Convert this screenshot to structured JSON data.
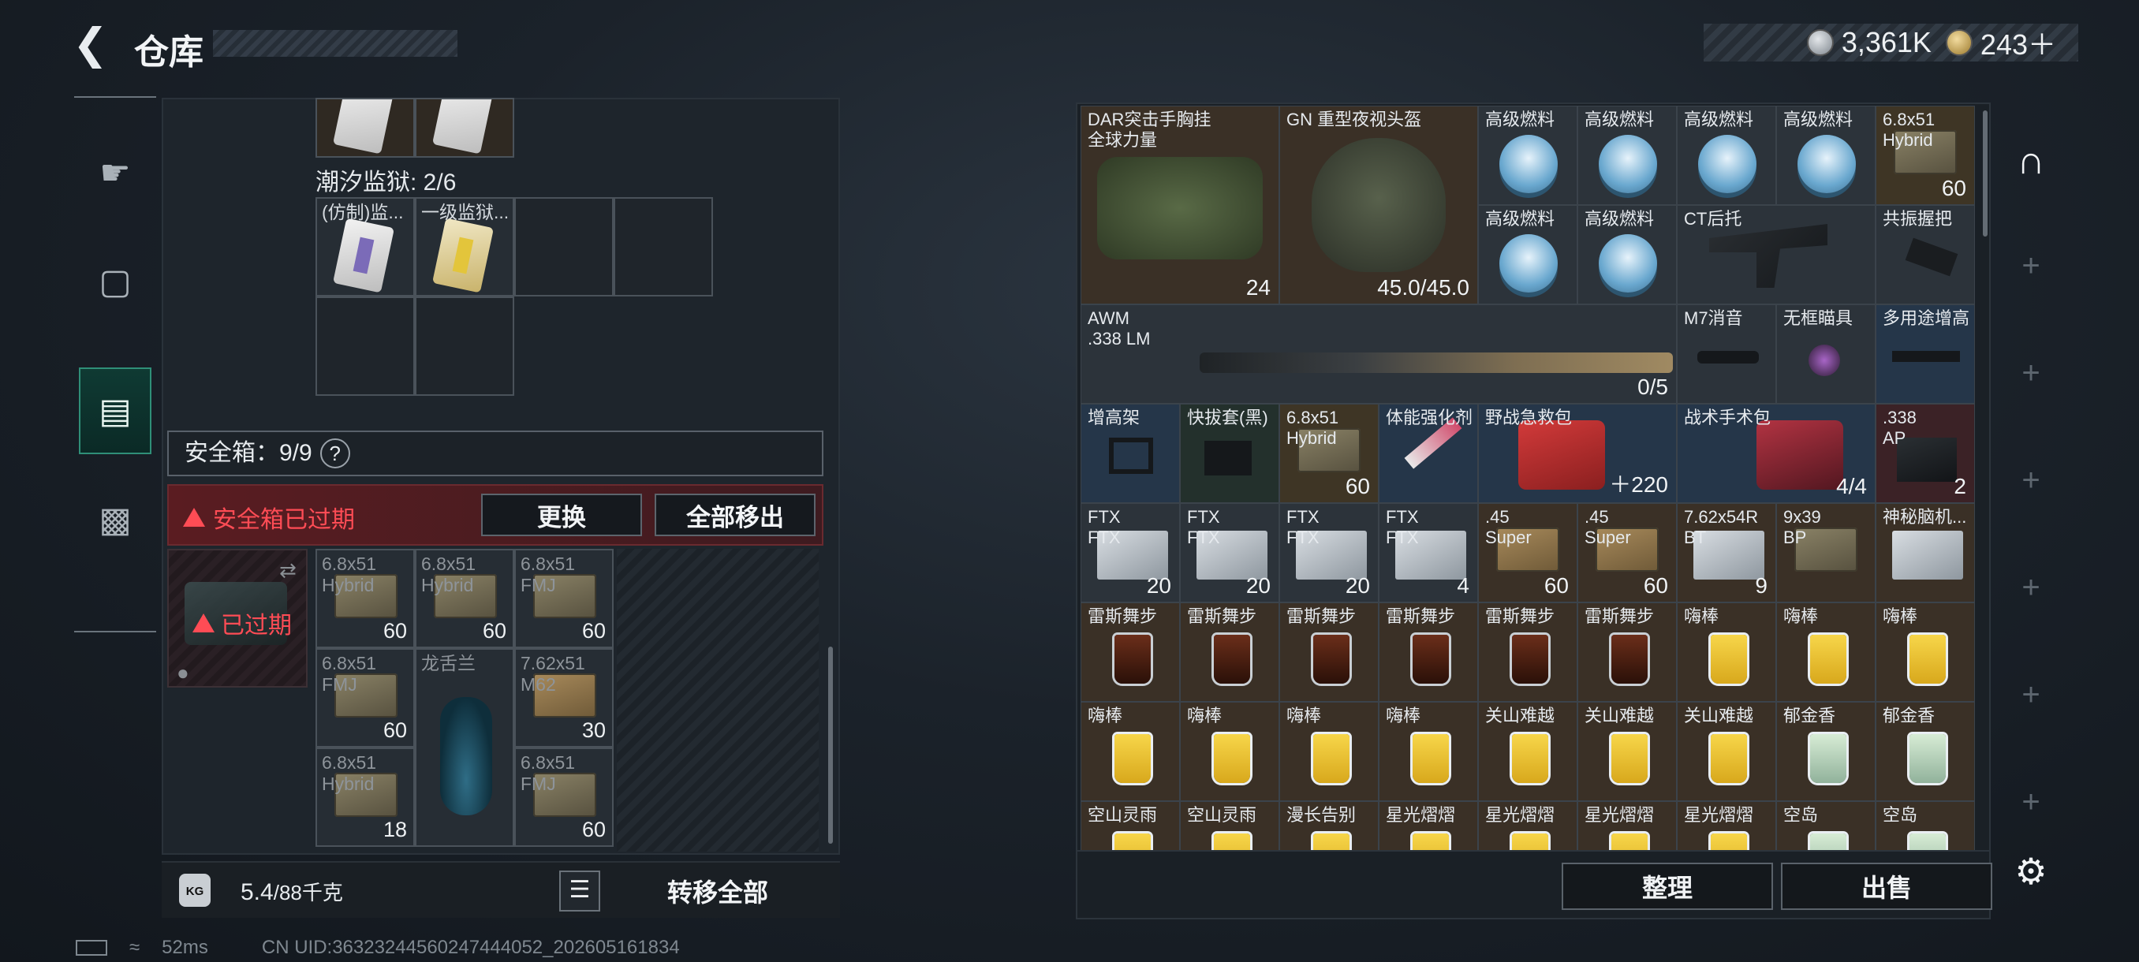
{
  "header": {
    "back_icon": "back-arrow-icon",
    "title": "仓库"
  },
  "currency": [
    {
      "icon": "silver-coin-icon",
      "value": "3,361K"
    },
    {
      "icon": "gold-coin-icon",
      "value": "243＋"
    }
  ],
  "left_rail": {
    "items": [
      "weapon-icon",
      "backpack-icon",
      "safe-box-icon",
      "briefcase-icon"
    ],
    "active": "safe-box-icon"
  },
  "left_panel": {
    "prison_section": {
      "label": "潮汐监狱: 2/6",
      "cards": [
        "(仿制)监...",
        "一级监狱..."
      ]
    },
    "safe_box": {
      "label": "安全箱：9/9",
      "help": "?"
    },
    "expired": {
      "warning": "安全箱已过期",
      "replace": "更换",
      "remove_all": "全部移出",
      "badge": "已过期"
    },
    "items": [
      {
        "label": "6.8x51\nHybrid",
        "count": "60"
      },
      {
        "label": "6.8x51\nHybrid",
        "count": "60"
      },
      {
        "label": "6.8x51\nFMJ",
        "count": "60"
      },
      {
        "label": "6.8x51\nFMJ",
        "count": "60"
      },
      {
        "label": "龙舌兰",
        "count": ""
      },
      {
        "label": "7.62x51\nM62",
        "count": "30"
      },
      {
        "label": "6.8x51\nHybrid",
        "count": "18"
      },
      {
        "label": "6.8x51\nFMJ",
        "count": "60"
      }
    ],
    "weight": {
      "icon_text": "KG",
      "current": "5.4",
      "max": "/88千克"
    },
    "transfer_all": "转移全部"
  },
  "status_bar": {
    "ping": "52ms",
    "uid": "CN UID:36323244560247444052_202605161834"
  },
  "right_grid": {
    "row1": [
      {
        "label": "DAR突击手胸挂\n全球力量",
        "count": "24"
      },
      {
        "label": "GN 重型夜视头盔",
        "count": "45.0/45.0"
      },
      {
        "label": "高级燃料"
      },
      {
        "label": "高级燃料"
      },
      {
        "label": "高级燃料"
      },
      {
        "label": "高级燃料"
      },
      {
        "label": "6.8x51\nHybrid",
        "count": "60"
      }
    ],
    "row2": [
      {
        "label": "高级燃料"
      },
      {
        "label": "高级燃料"
      },
      {
        "label": "CT后托"
      },
      {
        "label": "共振握把"
      }
    ],
    "row3": [
      {
        "label": "AWM\n.338 LM",
        "count": "0/5"
      },
      {
        "label": "M7消音"
      },
      {
        "label": "无框瞄具"
      },
      {
        "label": "多用途增高"
      }
    ],
    "row4": [
      {
        "label": "增高架"
      },
      {
        "label": "快拔套(黑)"
      },
      {
        "label": "6.8x51\nHybrid",
        "count": "60"
      },
      {
        "label": "体能强化剂"
      },
      {
        "label": "野战急救包",
        "count": "220"
      },
      {
        "label": "战术手术包",
        "count": "4/4"
      },
      {
        "label": ".338\nAP",
        "count": "2"
      }
    ],
    "row5": [
      {
        "label": "FTX\nFTX",
        "count": "20"
      },
      {
        "label": "FTX\nFTX",
        "count": "20"
      },
      {
        "label": "FTX\nFTX",
        "count": "20"
      },
      {
        "label": "FTX\nFTX",
        "count": "4"
      },
      {
        "label": ".45\nSuper",
        "count": "60"
      },
      {
        "label": ".45\nSuper",
        "count": "60"
      },
      {
        "label": "7.62x54R\nBT",
        "count": "9"
      },
      {
        "label": "9x39\nBP",
        "count": ""
      },
      {
        "label": "神秘脑机...",
        "count": ""
      }
    ],
    "row6": [
      "雷斯舞步",
      "雷斯舞步",
      "雷斯舞步",
      "雷斯舞步",
      "雷斯舞步",
      "雷斯舞步",
      "嗨棒",
      "嗨棒",
      "嗨棒"
    ],
    "row7": [
      "嗨棒",
      "嗨棒",
      "嗨棒",
      "嗨棒",
      "关山难越",
      "关山难越",
      "关山难越",
      "郁金香",
      "郁金香"
    ],
    "row8": [
      "空山灵雨",
      "空山灵雨",
      "漫长告别",
      "星光熠熠",
      "星光熠熠",
      "星光熠熠",
      "星光熠熠",
      "空岛",
      "空岛"
    ]
  },
  "right_rail": {
    "items": [
      "shelter-icon",
      "plus-icon",
      "plus-icon",
      "plus-icon",
      "plus-icon",
      "plus-icon",
      "plus-icon",
      "plus-icon"
    ]
  },
  "buttons": {
    "sort": "整理",
    "sell": "出售",
    "settings_icon": "gear-icon"
  }
}
